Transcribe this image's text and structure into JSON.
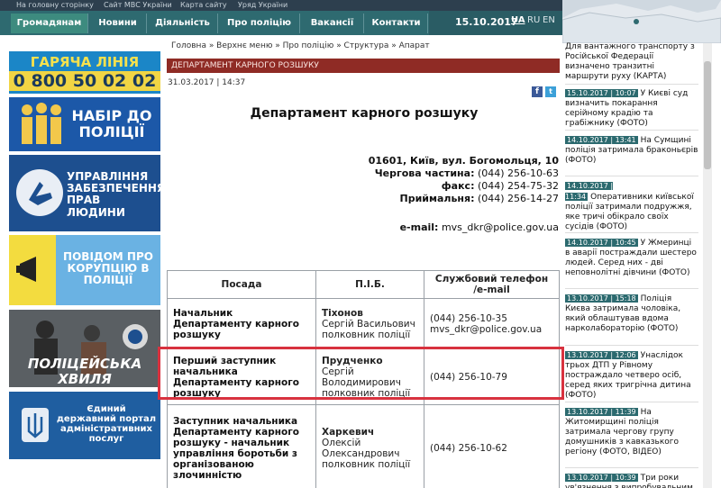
{
  "top_links": [
    "На головну сторінку",
    "Сайт МВС України",
    "Карта сайту",
    "Уряд України"
  ],
  "nav": {
    "items": [
      "Громадянам",
      "Новини",
      "Діяльність",
      "Про поліцію",
      "Вакансії",
      "Контакти"
    ],
    "date": "15.10.2017",
    "languages": [
      "UA",
      "RU",
      "EN"
    ],
    "active_language": "UA"
  },
  "banners": {
    "hotline_title": "ГАРЯЧА ЛІНІЯ",
    "hotline_number": "0 800 50 02 02",
    "recruit": "НАБІР ДО ПОЛІЦІЇ",
    "human_rights": "УПРАВЛІННЯ ЗАБЕЗПЕЧЕННЯ ПРАВ ЛЮДИНИ",
    "corruption": "ПОВІДОМ ПРО КОРУПЦІЮ В ПОЛІЦІЇ",
    "wave": "ПОЛІЦЕЙСЬКА ХВИЛЯ",
    "portal": "Єдиний державний портал адміністративних послуг"
  },
  "breadcrumb": "Головна » Верхнє меню » Про поліцію » Структура » Апарат",
  "section_bar": "ДЕПАРТАМЕНТ КАРНОГО РОЗШУКУ",
  "published": "31.03.2017 | 14:37",
  "page_title": "Департамент карного розшуку",
  "contacts": {
    "address": "01601, Київ, вул. Богомольця, 10",
    "duty_label": "Чергова частина:",
    "duty_phone": "(044) 256-10-63",
    "fax_label": "факс:",
    "fax_phone": "(044) 254-75-32",
    "reception_label": "Приймальня:",
    "reception_phone": "(044) 256-14-27",
    "email_label": "e-mail:",
    "email": "mvs_dkr@police.gov.ua"
  },
  "table": {
    "headers": [
      "Посада",
      "П.І.Б.",
      "Службовий телефон /e-mail"
    ],
    "rows": [
      {
        "position": "Начальник Департаменту карного розшуку",
        "surname": "Тіхонов",
        "given": "Сергій Васильович",
        "rank": "полковник поліції",
        "phone": "(044) 256-10-35",
        "email": "mvs_dkr@police.gov.ua"
      },
      {
        "position": "Перший заступник начальника Департаменту карного розшуку",
        "surname": "Прудченко",
        "given": "Сергій Володимирович",
        "rank": "полковник поліції",
        "phone": "(044) 256-10-79",
        "email": ""
      },
      {
        "position": "Заступник начальника Департаменту карного розшуку - начальник управління боротьби з організованою злочинністю",
        "surname": "Харкевич",
        "given": "Олексій Олександрович",
        "rank": "полковник поліції",
        "phone": "(044) 256-10-62",
        "email": ""
      }
    ]
  },
  "news": [
    {
      "date": "",
      "text": "Для вантажного транспорту з Російської Федерації визначено транзитні маршрути руху (КАРТА)"
    },
    {
      "date": "15.10.2017 | 10:07",
      "text": "У Києві суд визначить покарання серійному крадію та грабіжнику (ФОТО)"
    },
    {
      "date": "14.10.2017 | 13:41",
      "text": "На Сумщині поліція затримала браконьєрів (ФОТО)"
    },
    {
      "date": "14.10.2017 | 11:34",
      "text": "Оперативники київської поліції затримали подружжя, яке тричі обікрало своїх сусідів (ФОТО)"
    },
    {
      "date": "14.10.2017 | 10:45",
      "text": "У Жмеринці в аварії постраждали шестеро людей. Серед них - дві неповнолітні дівчини (ФОТО)"
    },
    {
      "date": "13.10.2017 | 15:18",
      "text": "Поліція Києва затримала чоловіка, який облаштував вдома нарколабораторію (ФОТО)"
    },
    {
      "date": "13.10.2017 | 12:06",
      "text": "Унаслідок трьох ДТП у Рівному постраждало четверо осіб, серед яких тригрічна дитина (ФОТО)"
    },
    {
      "date": "13.10.2017 | 11:39",
      "text": "На Житомирщині поліція затримала чергову групу домушників з кавказького регіону (ФОТО, ВІДЕО)"
    },
    {
      "date": "13.10.2017 | 10:39",
      "text": "Три роки ув'язнення з випробувальним"
    }
  ],
  "colors": {
    "nav_bg": "#2e6a70",
    "section_bar": "#8f2b25",
    "highlight": "#d8323f",
    "hotline": "#1b86c7"
  }
}
